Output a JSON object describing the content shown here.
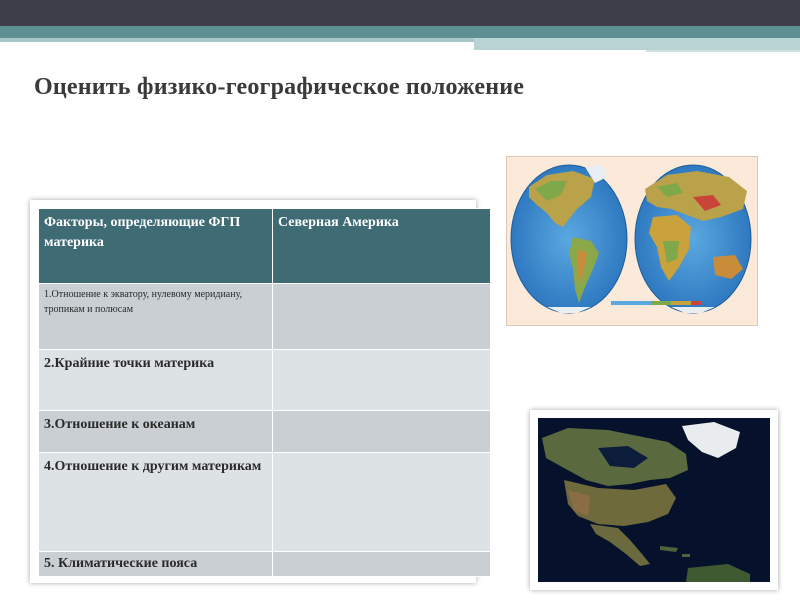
{
  "slide": {
    "title": "Оценить  физико-географическое положение"
  },
  "table": {
    "headers": [
      "Факторы, определяющие ФГП материка",
      "Северная Америка"
    ],
    "rows": [
      {
        "factor": "1.Отношение к экватору, нулевому меридиану, тропикам и полюсам",
        "value": ""
      },
      {
        "factor": "2.Крайние точки материка",
        "value": ""
      },
      {
        "factor": "3.Отношение к океанам",
        "value": ""
      },
      {
        "factor": "4.Отношение к другим материкам",
        "value": ""
      },
      {
        "factor": "5. Климатические пояса",
        "value": ""
      }
    ]
  },
  "colors": {
    "header_bg": "#3f6b75",
    "row_dark": "#c9cfd2",
    "row_light": "#dde2e4",
    "title": "#3a3a3a",
    "ocean": "#3d8fd1",
    "land": "#c9a23d"
  },
  "images": {
    "hemispheres_map": "physical-map-of-hemispheres",
    "north_america_photo": "satellite-photo-north-america"
  }
}
